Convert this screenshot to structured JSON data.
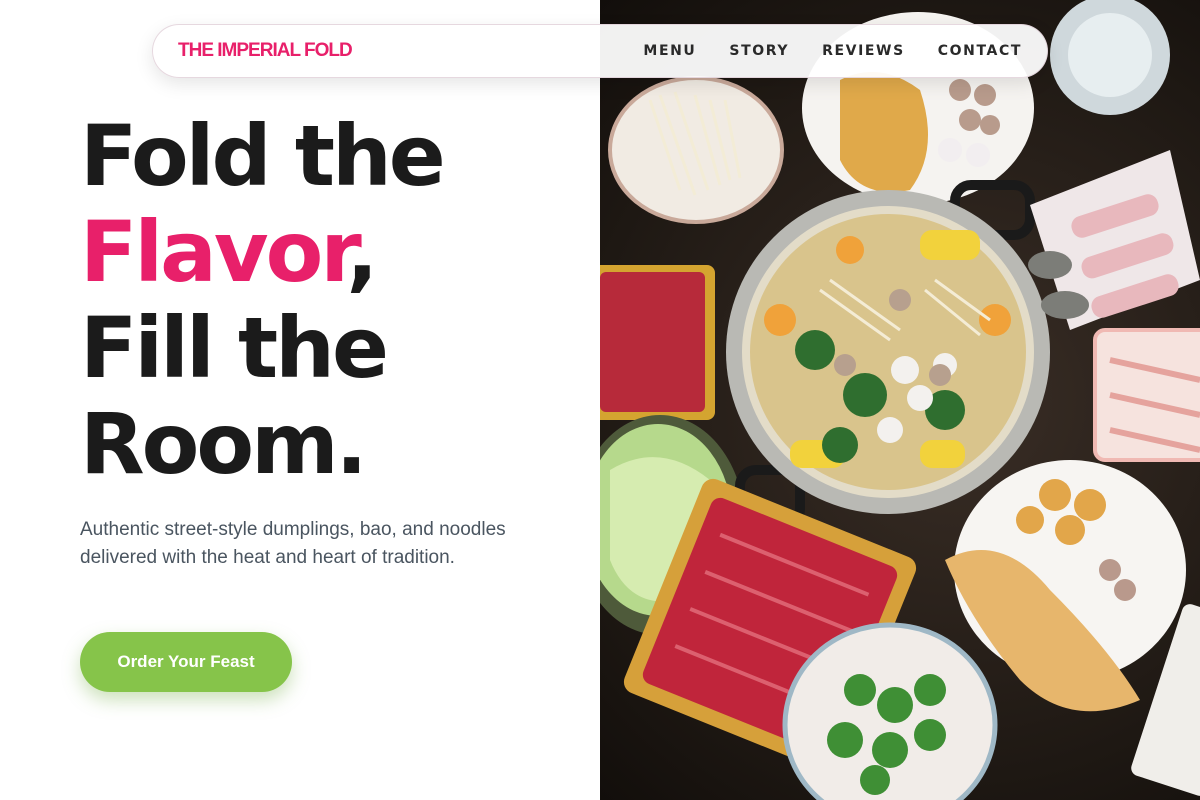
{
  "brand": {
    "name": "THE IMPERIAL FOLD"
  },
  "nav": {
    "links": [
      "MENU",
      "STORY",
      "REVIEWS",
      "CONTACT"
    ]
  },
  "hero": {
    "line1": "Fold the",
    "accent": "Flavor",
    "comma": ",",
    "line3": "Fill the",
    "line4": "Room.",
    "subtitle": "Authentic street-style dumplings, bao, and noodles delivered with the heat and heart of tradition.",
    "cta_label": "Order Your Feast"
  },
  "colors": {
    "accent": "#e8206a",
    "cta": "#86c44a",
    "text": "#1b1b1b",
    "subtitle": "#4a5560"
  }
}
